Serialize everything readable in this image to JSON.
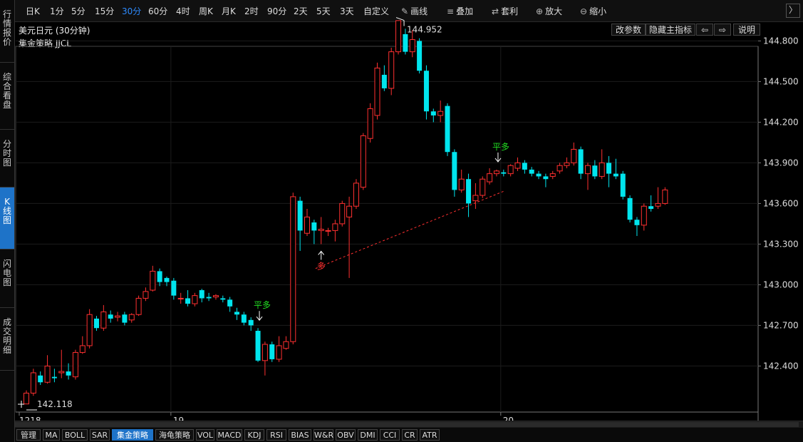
{
  "sidebar": {
    "tabs": [
      {
        "label": "行情报价",
        "active": false
      },
      {
        "label": "综合看盘",
        "active": false
      },
      {
        "label": "分时图",
        "active": false
      },
      {
        "label": "K线图",
        "active": true
      },
      {
        "label": "闪电图",
        "active": false
      },
      {
        "label": "成交明细",
        "active": false
      }
    ]
  },
  "toolbar": {
    "periods": [
      "日K",
      "1分",
      "5分",
      "15分",
      "30分",
      "60分",
      "4时",
      "周K",
      "月K",
      "2时",
      "90分",
      "2天",
      "5天",
      "3天",
      "自定义"
    ],
    "active_period": "30分",
    "draw_label": "画线",
    "overlay_label": "叠加",
    "arbitrage_label": "套利",
    "zoom_in_label": "放大",
    "zoom_out_label": "缩小",
    "nav_arrow": "〉"
  },
  "header": {
    "title": "美元日元 (30分钟)",
    "indicator": "集金策略 JJCL",
    "buttons": {
      "params": "改参数",
      "hide_indicator": "隐藏主指标",
      "left_arrow": "⇦",
      "right_arrow": "⇨",
      "help": "说明"
    }
  },
  "bottom_tabs": {
    "items": [
      "管理",
      "MA",
      "BOLL",
      "SAR",
      "集金策略",
      "海龟策略",
      "VOL",
      "MACD",
      "KDJ",
      "RSI",
      "BIAS",
      "W&R",
      "OBV",
      "DMI",
      "CCI",
      "CR",
      "ATR"
    ],
    "active": "集金策略"
  },
  "chart_data": {
    "type": "candlestick",
    "ylim": [
      142.1,
      145.05
    ],
    "yticks": [
      "142.400",
      "142.700",
      "143.000",
      "143.300",
      "143.600",
      "143.900",
      "144.200",
      "144.500",
      "144.800"
    ],
    "xlabels": [
      {
        "text": "1218",
        "index": 0
      },
      {
        "text": "19",
        "index": 21
      },
      {
        "text": "20",
        "index": 68
      }
    ],
    "annotations": {
      "high_label": "144.952",
      "low_label": "142.118",
      "signals": [
        {
          "text": "平多",
          "index": 33,
          "color": "#22dd22",
          "dir": "down"
        },
        {
          "text": "多",
          "index": 42,
          "color": "#ff3030",
          "dir": "up"
        },
        {
          "text": "平多",
          "index": 67,
          "color": "#22dd22",
          "dir": "down"
        }
      ]
    },
    "colors": {
      "up": "#ff3030",
      "down": "#00e5ee",
      "grid": "#1c1c1c",
      "axis": "#444444"
    },
    "candles": [
      [
        142.12,
        142.2,
        142.12,
        142.22
      ],
      [
        142.2,
        142.35,
        142.18,
        142.38
      ],
      [
        142.33,
        142.28,
        142.26,
        142.36
      ],
      [
        142.28,
        142.4,
        142.27,
        142.48
      ],
      [
        142.32,
        142.31,
        142.28,
        142.38
      ],
      [
        142.35,
        142.36,
        142.31,
        142.52
      ],
      [
        142.36,
        142.33,
        142.3,
        142.42
      ],
      [
        142.32,
        142.5,
        142.3,
        142.52
      ],
      [
        142.5,
        142.55,
        142.49,
        142.62
      ],
      [
        142.55,
        142.78,
        142.53,
        142.82
      ],
      [
        142.75,
        142.68,
        142.66,
        142.77
      ],
      [
        142.68,
        142.8,
        142.66,
        142.85
      ],
      [
        142.78,
        142.75,
        142.72,
        142.81
      ],
      [
        142.76,
        142.77,
        142.73,
        142.8
      ],
      [
        142.78,
        142.72,
        142.7,
        142.8
      ],
      [
        142.74,
        142.78,
        142.72,
        142.79
      ],
      [
        142.78,
        142.9,
        142.77,
        142.92
      ],
      [
        142.9,
        142.95,
        142.88,
        142.98
      ],
      [
        142.96,
        143.1,
        142.95,
        143.14
      ],
      [
        143.1,
        143.02,
        142.99,
        143.12
      ],
      [
        143.05,
        143.02,
        142.99,
        143.06
      ],
      [
        143.03,
        142.92,
        142.89,
        143.05
      ],
      [
        142.9,
        142.9,
        142.86,
        142.94
      ],
      [
        142.9,
        142.86,
        142.84,
        142.96
      ],
      [
        142.86,
        142.92,
        142.84,
        142.94
      ],
      [
        142.96,
        142.9,
        142.87,
        142.97
      ],
      [
        142.91,
        142.9,
        142.88,
        142.94
      ],
      [
        142.91,
        142.92,
        142.89,
        142.93
      ],
      [
        142.9,
        142.89,
        142.87,
        142.92
      ],
      [
        142.89,
        142.84,
        142.8,
        142.91
      ],
      [
        142.8,
        142.78,
        142.74,
        142.83
      ],
      [
        142.78,
        142.72,
        142.7,
        142.8
      ],
      [
        142.74,
        142.7,
        142.66,
        142.76
      ],
      [
        142.66,
        142.44,
        142.43,
        142.68
      ],
      [
        142.44,
        142.56,
        142.33,
        142.58
      ],
      [
        142.56,
        142.45,
        142.43,
        142.58
      ],
      [
        142.45,
        142.55,
        142.43,
        142.62
      ],
      [
        142.53,
        142.58,
        142.52,
        142.62
      ],
      [
        142.58,
        143.65,
        142.56,
        143.68
      ],
      [
        143.62,
        143.4,
        143.25,
        143.65
      ],
      [
        143.38,
        143.5,
        143.36,
        143.56
      ],
      [
        143.46,
        143.4,
        143.3,
        143.48
      ],
      [
        143.4,
        143.41,
        143.3,
        143.5
      ],
      [
        143.4,
        143.4,
        143.36,
        143.42
      ],
      [
        143.4,
        143.45,
        143.32,
        143.48
      ],
      [
        143.45,
        143.6,
        143.43,
        143.62
      ],
      [
        143.5,
        143.58,
        143.05,
        143.65
      ],
      [
        143.58,
        143.75,
        143.56,
        143.78
      ],
      [
        143.72,
        144.1,
        143.7,
        144.12
      ],
      [
        144.08,
        144.3,
        144.05,
        144.34
      ],
      [
        144.25,
        144.6,
        144.22,
        144.64
      ],
      [
        144.55,
        144.45,
        144.43,
        144.62
      ],
      [
        144.45,
        144.72,
        144.4,
        144.75
      ],
      [
        144.72,
        144.95,
        144.7,
        144.95
      ],
      [
        144.85,
        144.72,
        144.7,
        144.89
      ],
      [
        144.72,
        144.81,
        144.68,
        144.88
      ],
      [
        144.8,
        144.58,
        144.56,
        144.82
      ],
      [
        144.58,
        144.28,
        144.22,
        144.62
      ],
      [
        144.28,
        144.25,
        144.2,
        144.3
      ],
      [
        144.25,
        144.28,
        144.2,
        144.36
      ],
      [
        144.32,
        143.98,
        143.95,
        144.34
      ],
      [
        143.98,
        143.7,
        143.65,
        144.0
      ],
      [
        143.7,
        143.78,
        143.68,
        143.85
      ],
      [
        143.78,
        143.6,
        143.5,
        143.82
      ],
      [
        143.62,
        143.66,
        143.56,
        143.75
      ],
      [
        143.66,
        143.78,
        143.64,
        143.8
      ],
      [
        143.76,
        143.82,
        143.74,
        143.86
      ],
      [
        143.82,
        143.84,
        143.8,
        143.85
      ],
      [
        143.83,
        143.82,
        143.8,
        143.85
      ],
      [
        143.82,
        143.88,
        143.8,
        143.89
      ],
      [
        143.86,
        143.9,
        143.84,
        143.94
      ],
      [
        143.9,
        143.85,
        143.82,
        143.92
      ],
      [
        143.85,
        143.82,
        143.8,
        143.87
      ],
      [
        143.82,
        143.8,
        143.78,
        143.84
      ],
      [
        143.8,
        143.78,
        143.72,
        143.82
      ],
      [
        143.8,
        143.82,
        143.78,
        143.84
      ],
      [
        143.84,
        143.88,
        143.82,
        143.9
      ],
      [
        143.88,
        143.9,
        143.86,
        143.94
      ],
      [
        143.9,
        144.0,
        143.88,
        144.05
      ],
      [
        144.0,
        143.82,
        143.78,
        144.02
      ],
      [
        143.82,
        143.88,
        143.7,
        143.9
      ],
      [
        143.88,
        143.8,
        143.78,
        143.92
      ],
      [
        143.8,
        143.9,
        143.78,
        144.0
      ],
      [
        143.9,
        143.82,
        143.72,
        143.95
      ],
      [
        143.82,
        143.8,
        143.78,
        143.93
      ],
      [
        143.82,
        143.65,
        143.63,
        143.84
      ],
      [
        143.64,
        143.48,
        143.46,
        143.66
      ],
      [
        143.48,
        143.44,
        143.36,
        143.5
      ],
      [
        143.44,
        143.58,
        143.4,
        143.6
      ],
      [
        143.58,
        143.56,
        143.54,
        143.66
      ],
      [
        143.58,
        143.6,
        143.56,
        143.72
      ],
      [
        143.6,
        143.7,
        143.59,
        143.72
      ]
    ]
  }
}
